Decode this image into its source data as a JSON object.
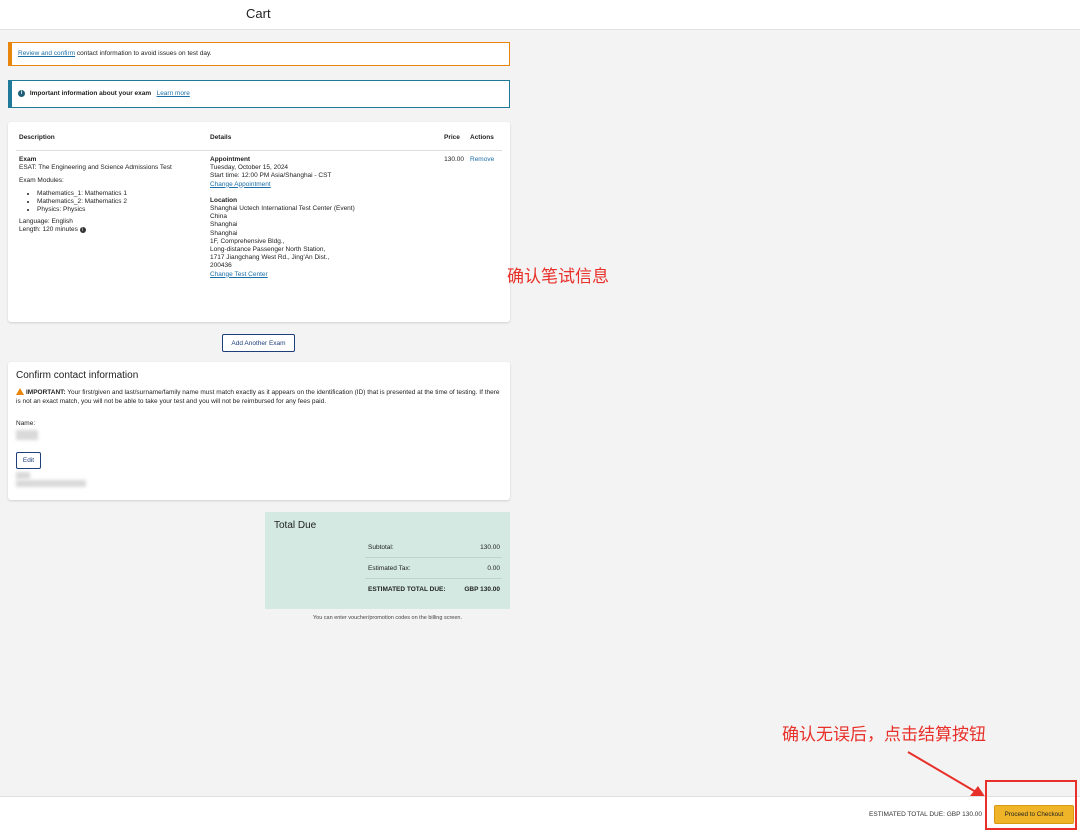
{
  "header": {
    "title": "Cart"
  },
  "alerts": {
    "review_link": "Review and confirm",
    "review_text": " contact information to avoid issues on test day.",
    "info_icon": "info-circle-icon",
    "info_bold": "Important information about your exam",
    "info_link": "Learn more"
  },
  "exam_table": {
    "headers": {
      "description": "Description",
      "details": "Details",
      "price": "Price",
      "actions": "Actions"
    },
    "exam_title": "Exam",
    "exam_name": "ESAT: The Engineering and Science Admissions Test",
    "modules_label": "Exam Modules:",
    "modules": [
      "Mathematics_1: Mathematics 1",
      "Mathematics_2: Mathematics 2",
      "Physics: Physics"
    ],
    "language": "Language: English",
    "length": "Length: 120 minutes",
    "appointment_title": "Appointment",
    "appointment_date": "Tuesday, October 15, 2024",
    "appointment_time": "Start time: 12:00 PM Asia/Shanghai - CST",
    "change_appointment": "Change Appointment",
    "location_title": "Location",
    "location_lines": [
      "Shanghai Uctech International Test Center (Event)",
      "China",
      "Shanghai",
      "Shanghai",
      "1F, Comprehensive Bldg.,",
      "Long-distance Passenger North Station,",
      "1717 Jiangchang West Rd., Jing'An Dist.,",
      "200436"
    ],
    "change_test_center": "Change Test Center",
    "price": "130.00",
    "remove": "Remove"
  },
  "add_exam_button": "Add Another Exam",
  "contact": {
    "heading": "Confirm contact information",
    "warning_bold": "IMPORTANT:",
    "warning_text": " Your first/given and last/surname/family name must match exactly as it appears on the identification (ID) that is presented at the time of testing. If there is not an exact match, you will not be able to take your test and you will not be reimbursed for any fees paid.",
    "name_label": "Name:",
    "edit_button": "Edit"
  },
  "totals": {
    "title": "Total Due",
    "subtotal_label": "Subtotal:",
    "subtotal_value": "130.00",
    "tax_label": "Estimated Tax:",
    "tax_value": "0.00",
    "total_label": "ESTIMATED TOTAL DUE:",
    "total_value": "GBP 130.00",
    "voucher_note": "You can enter voucher/promotion codes on the billing screen."
  },
  "annotations": {
    "confirm_exam_info": "确认笔试信息",
    "confirm_then_checkout": "确认无误后，点击结算按钮"
  },
  "footer": {
    "estimated_total": "ESTIMATED TOTAL DUE: GBP 130.00",
    "checkout_button": "Proceed to Checkout"
  },
  "colors": {
    "accent_orange": "#e8850c",
    "info_teal": "#1f7a99",
    "link": "#1a6ea8",
    "checkout": "#f0b429",
    "annotation_red": "#e8302a",
    "total_bg": "#d3e9e2"
  }
}
